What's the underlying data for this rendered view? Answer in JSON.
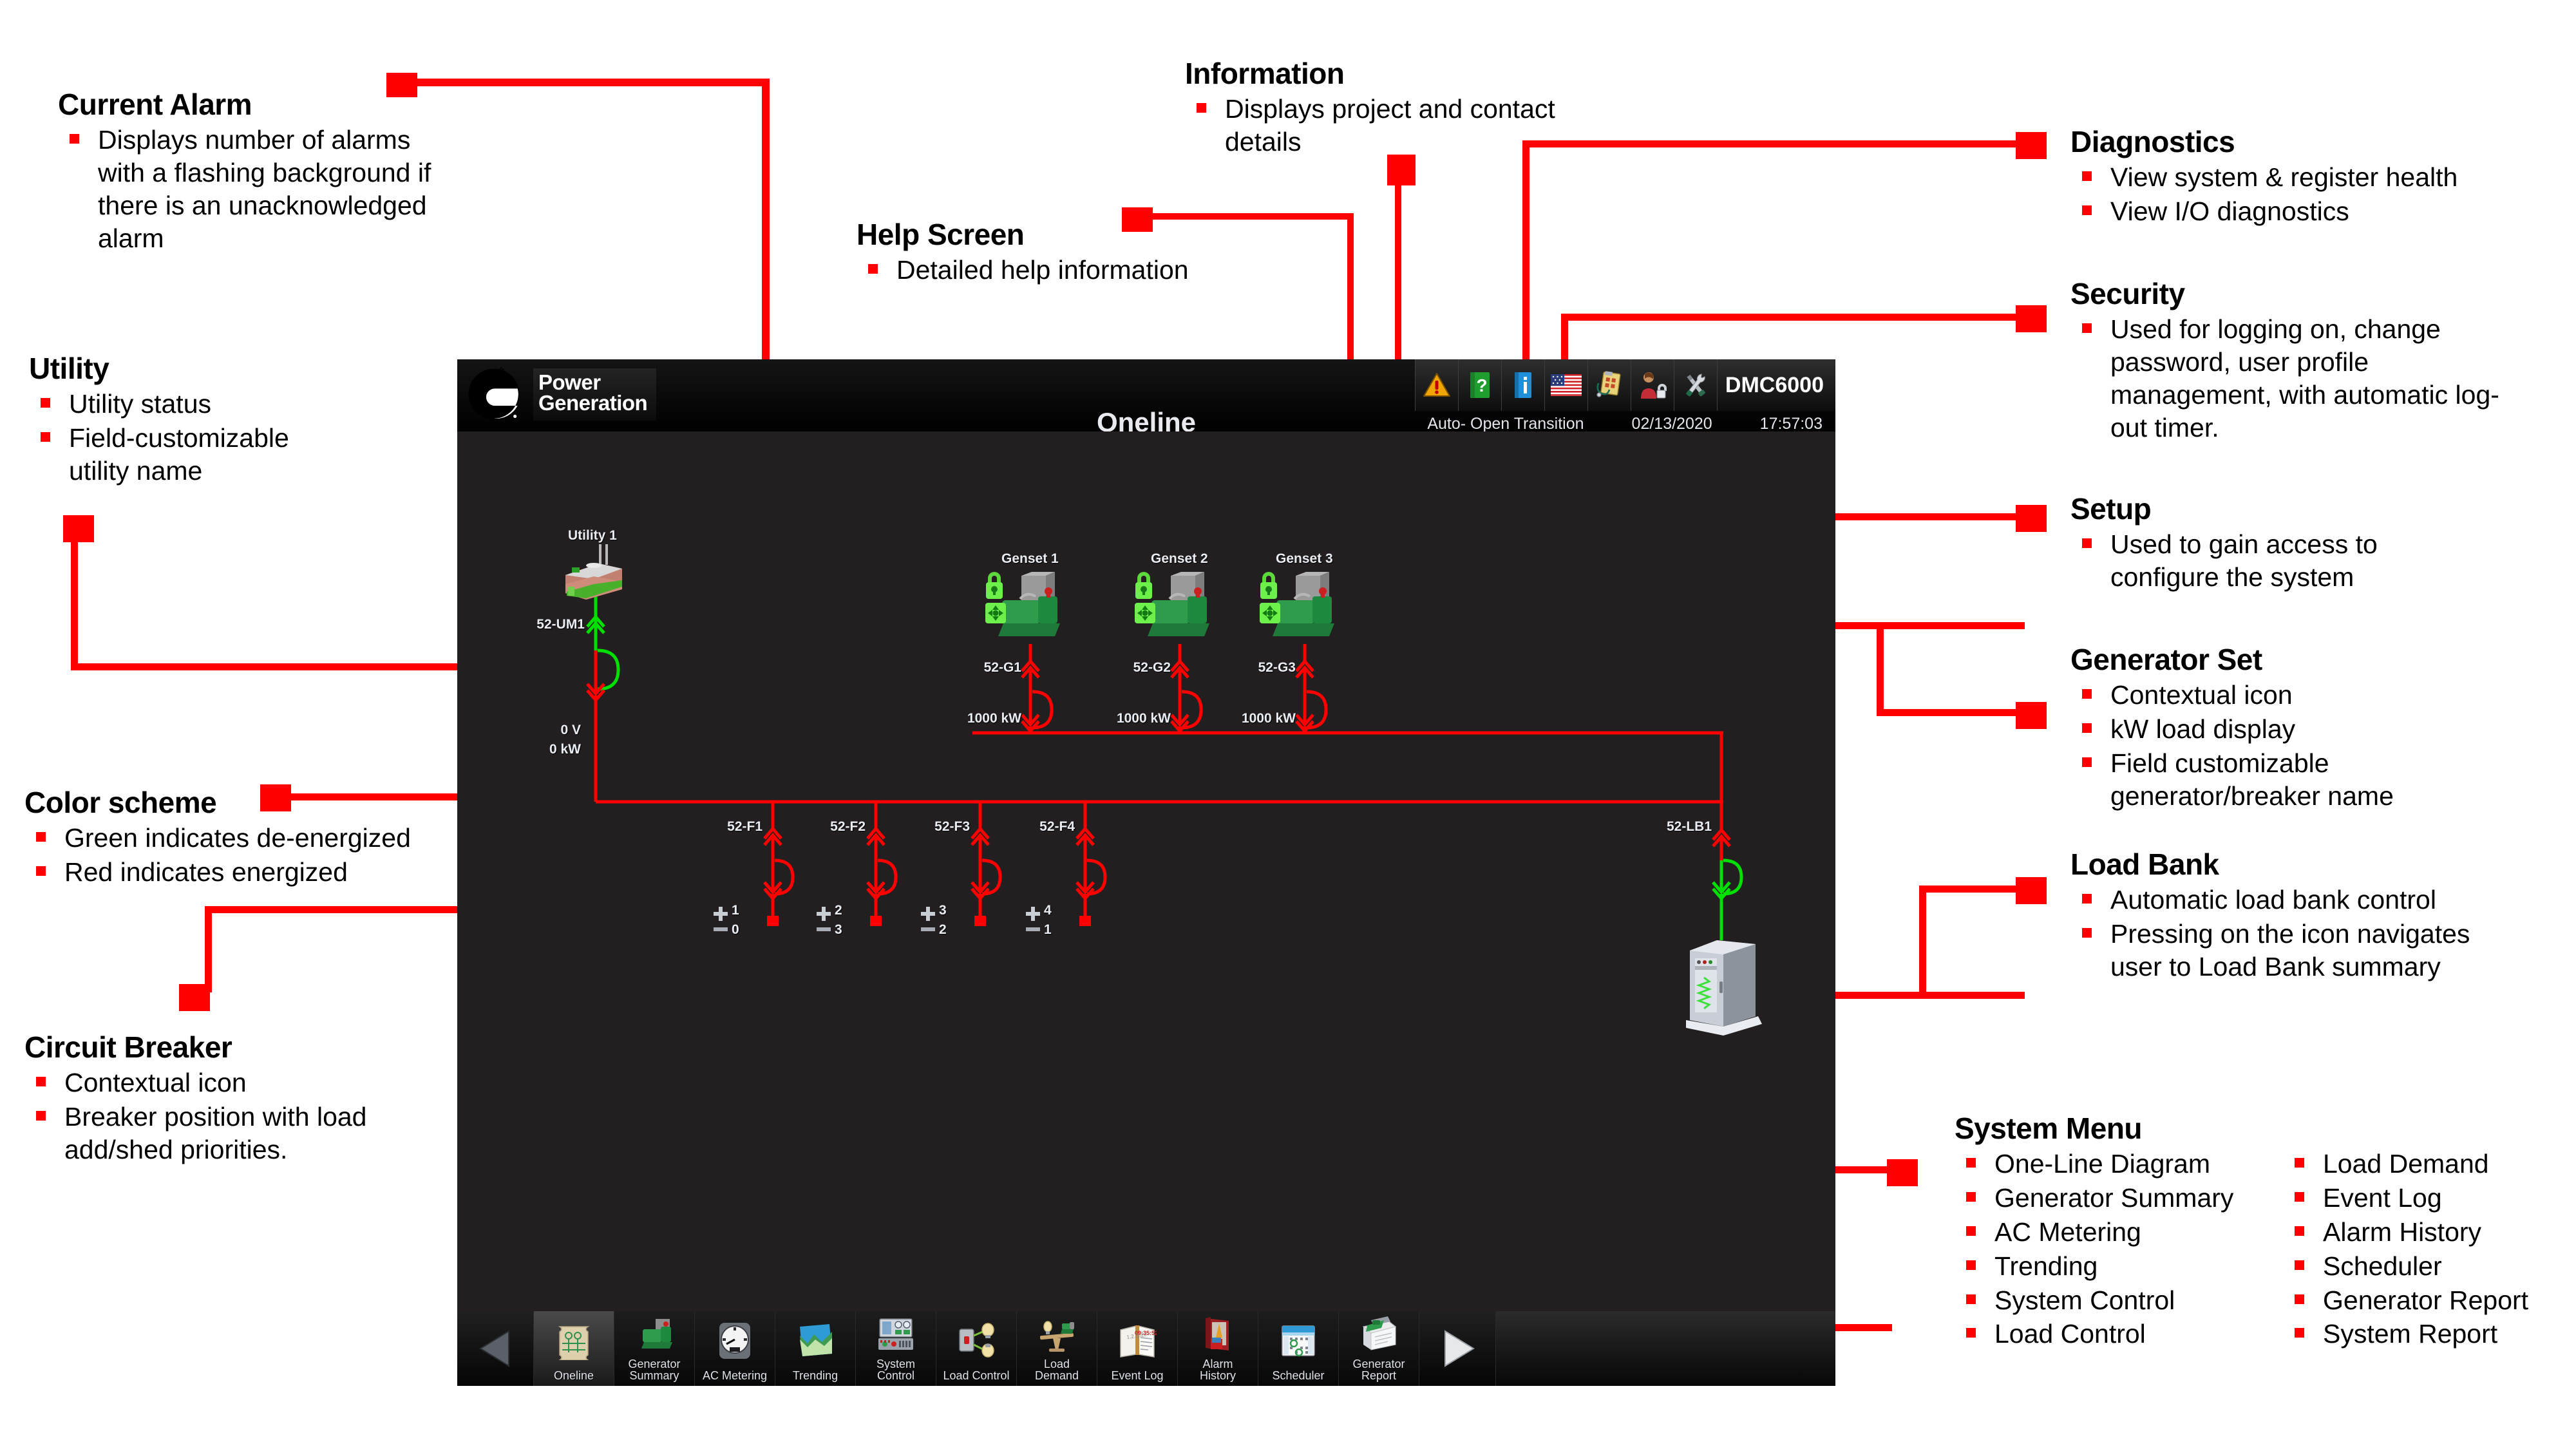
{
  "device": {
    "brand_line1": "Power",
    "brand_line2": "Generation",
    "logo_wordmark": "Cummins",
    "model": "DMC6000",
    "screen_title": "Oneline",
    "status": {
      "mode": "Auto- Open Transition",
      "date": "02/13/2020",
      "time": "17:57:03"
    },
    "toolbar": [
      {
        "name": "current-alarm-icon",
        "label": "Current Alarm"
      },
      {
        "name": "help-icon",
        "label": "Help Screen"
      },
      {
        "name": "information-icon",
        "label": "Information"
      },
      {
        "name": "language-flag-icon",
        "label": "Language"
      },
      {
        "name": "diagnostics-icon",
        "label": "Diagnostics"
      },
      {
        "name": "security-icon",
        "label": "Security"
      },
      {
        "name": "setup-icon",
        "label": "Setup"
      }
    ],
    "navbar": {
      "prev_label": "◀",
      "next_label": "▶",
      "items": [
        {
          "line1": "Oneline",
          "line2": "",
          "selected": true
        },
        {
          "line1": "Generator",
          "line2": "Summary",
          "selected": false
        },
        {
          "line1": "AC Metering",
          "line2": "",
          "selected": false
        },
        {
          "line1": "Trending",
          "line2": "",
          "selected": false
        },
        {
          "line1": "System",
          "line2": "Control",
          "selected": false
        },
        {
          "line1": "Load Control",
          "line2": "",
          "selected": false
        },
        {
          "line1": "Load",
          "line2": "Demand",
          "selected": false
        },
        {
          "line1": "Event Log",
          "line2": "",
          "selected": false
        },
        {
          "line1": "Alarm",
          "line2": "History",
          "selected": false
        },
        {
          "line1": "Scheduler",
          "line2": "",
          "selected": false
        },
        {
          "line1": "Generator",
          "line2": "Report",
          "selected": false
        }
      ]
    },
    "oneline": {
      "utility": {
        "name": "Utility 1",
        "breaker": "52-UM1",
        "voltage": "0 V",
        "power": "0 kW"
      },
      "gensets": [
        {
          "name": "Genset 1",
          "breaker": "52-G1",
          "kw": "1000 kW"
        },
        {
          "name": "Genset 2",
          "breaker": "52-G2",
          "kw": "1000 kW"
        },
        {
          "name": "Genset 3",
          "breaker": "52-G3",
          "kw": "1000 kW"
        }
      ],
      "feeders": [
        {
          "breaker": "52-F1",
          "add": "1",
          "shed": "0"
        },
        {
          "breaker": "52-F2",
          "add": "2",
          "shed": "3"
        },
        {
          "breaker": "52-F3",
          "add": "3",
          "shed": "2"
        },
        {
          "breaker": "52-F4",
          "add": "4",
          "shed": "1"
        }
      ],
      "loadbank": {
        "breaker": "52-LB1"
      },
      "colors": {
        "energized": "#ff0000",
        "deenergized": "#00e000"
      }
    }
  },
  "annotations": {
    "current_alarm": {
      "title": "Current Alarm",
      "bullets": [
        "Displays number of alarms with a flashing background if there is an unacknowledged alarm"
      ]
    },
    "information": {
      "title": "Information",
      "bullets": [
        "Displays project and contact details"
      ]
    },
    "help_screen": {
      "title": "Help Screen",
      "bullets": [
        "Detailed help information"
      ]
    },
    "diagnostics": {
      "title": "Diagnostics",
      "bullets": [
        "View system & register health",
        "View I/O diagnostics"
      ]
    },
    "security": {
      "title": "Security",
      "bullets": [
        "Used for logging on, change password, user profile management, with automatic log-out timer."
      ]
    },
    "setup": {
      "title": "Setup",
      "bullets": [
        "Used to gain access to configure the system"
      ]
    },
    "generator_set": {
      "title": "Generator Set",
      "bullets": [
        "Contextual icon",
        "kW load display",
        "Field customizable generator/breaker name"
      ]
    },
    "load_bank": {
      "title": "Load Bank",
      "bullets": [
        "Automatic load bank control",
        "Pressing on the icon navigates user to Load Bank summary"
      ]
    },
    "utility": {
      "title": "Utility",
      "bullets": [
        "Utility status",
        "Field-customizable utility name"
      ]
    },
    "color_scheme": {
      "title": "Color scheme",
      "bullets": [
        "Green indicates de-energized",
        "Red indicates energized"
      ]
    },
    "circuit_breaker": {
      "title": "Circuit Breaker",
      "bullets": [
        "Contextual icon",
        "Breaker position with load add/shed priorities."
      ]
    },
    "system_menu": {
      "title": "System Menu",
      "col1": [
        "One-Line Diagram",
        "Generator Summary",
        "AC Metering",
        "Trending",
        "System Control",
        "Load Control"
      ],
      "col2": [
        "Load Demand",
        "Event Log",
        "Alarm History",
        "Scheduler",
        "Generator Report",
        "System Report"
      ]
    }
  }
}
